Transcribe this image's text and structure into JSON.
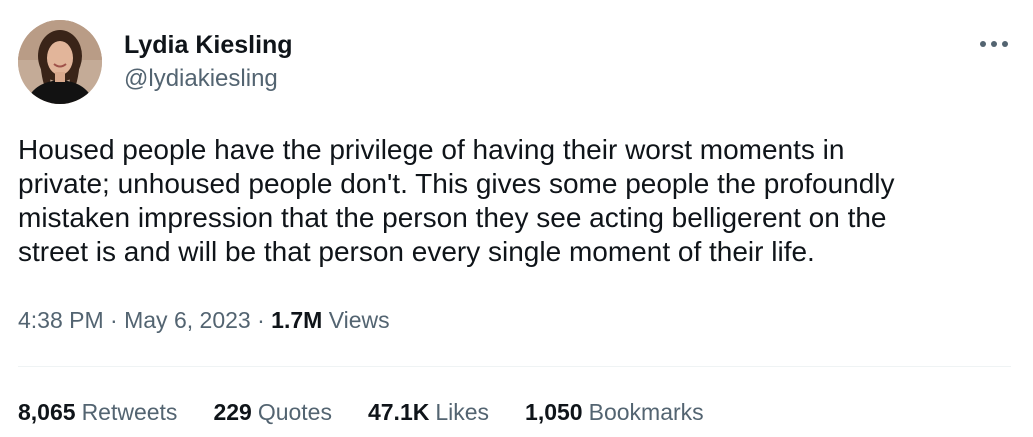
{
  "author": {
    "name": "Lydia Kiesling",
    "handle": "@lydiakiesling",
    "avatar_icon": "profile-photo"
  },
  "more_icon": "more-dots-icon",
  "tweet": {
    "text": "Housed people have the privilege of having their worst moments in\nprivate; unhoused people don't. This gives some people the profoundly\nmistaken impression that the person they see acting belligerent on the\nstreet is and will be that person every single moment of their life."
  },
  "meta": {
    "time": "4:38 PM",
    "separator1": " · ",
    "date": "May 6, 2023",
    "separator2": " · ",
    "views_count": "1.7M",
    "views_label": "Views"
  },
  "stats": {
    "retweets_count": "8,065",
    "retweets_label": "Retweets",
    "quotes_count": "229",
    "quotes_label": "Quotes",
    "likes_count": "47.1K",
    "likes_label": "Likes",
    "bookmarks_count": "1,050",
    "bookmarks_label": "Bookmarks"
  },
  "colors": {
    "text_primary": "#0f1419",
    "text_secondary": "#536471",
    "divider": "#eff3f4"
  }
}
